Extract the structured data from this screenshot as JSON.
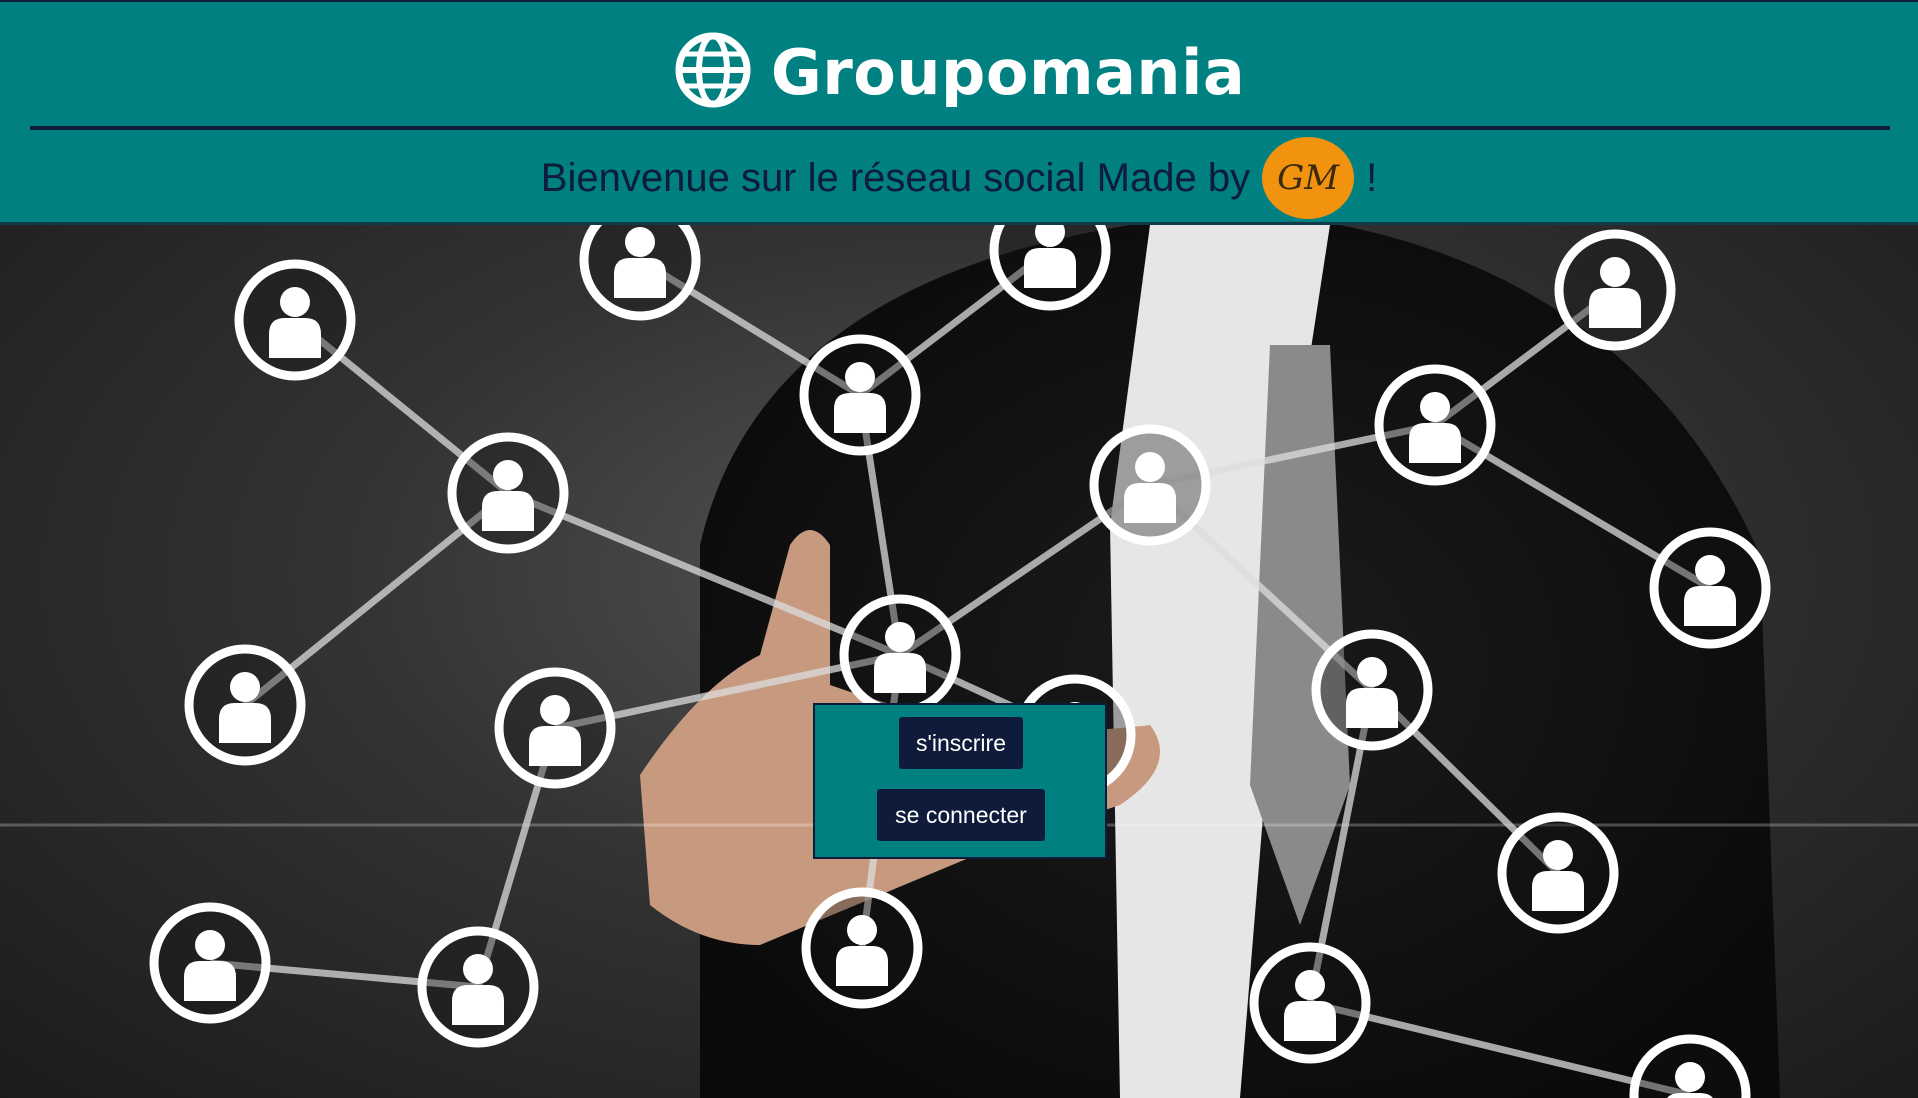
{
  "header": {
    "brand_name": "Groupomania",
    "brand_icon": "globe-icon",
    "welcome_text": "Bienvenue sur le réseau social Made by",
    "maker_logo_text": "GM",
    "welcome_suffix": "!"
  },
  "auth": {
    "signup_label": "s'inscrire",
    "login_label": "se connecter"
  },
  "colors": {
    "header_bg": "#008080",
    "navy": "#0e1b3a",
    "logo_orange": "#f2930f"
  },
  "hero": {
    "image_subject": "network-of-people-icons-with-businessman-pointing"
  }
}
